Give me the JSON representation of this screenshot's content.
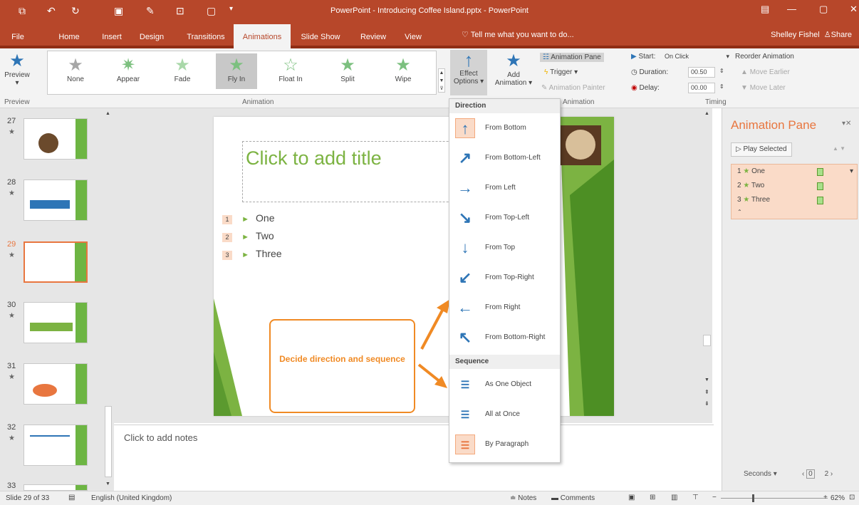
{
  "window": {
    "title": "PowerPoint - Introducing Coffee Island.pptx - PowerPoint"
  },
  "tabs": [
    "File",
    "Home",
    "Insert",
    "Design",
    "Transitions",
    "Animations",
    "Slide Show",
    "Review",
    "View"
  ],
  "tell_me": "Tell me what you want to do...",
  "user": {
    "name": "Shelley Fishel",
    "share": "Share"
  },
  "ribbon": {
    "preview": {
      "label": "Preview",
      "group": "Preview"
    },
    "animation_group": "Animation",
    "animations": [
      "None",
      "Appear",
      "Fade",
      "Fly In",
      "Float In",
      "Split",
      "Wipe"
    ],
    "selected_animation": "Fly In",
    "effect_options": {
      "line1": "Effect",
      "line2": "Options"
    },
    "add_animation": {
      "line1": "Add",
      "line2": "Animation"
    },
    "advanced": {
      "animation_pane": "Animation Pane",
      "trigger": "Trigger",
      "animation_painter": "Animation Painter",
      "group": "Animation"
    },
    "timing": {
      "start_label": "Start:",
      "start_value": "On Click",
      "duration_label": "Duration:",
      "duration_value": "00.50",
      "delay_label": "Delay:",
      "delay_value": "00.00",
      "group": "Timing"
    },
    "reorder": {
      "title": "Reorder Animation",
      "earlier": "Move Earlier",
      "later": "Move Later"
    }
  },
  "thumbnails": [
    {
      "num": "27"
    },
    {
      "num": "28"
    },
    {
      "num": "29"
    },
    {
      "num": "30"
    },
    {
      "num": "31"
    },
    {
      "num": "32"
    },
    {
      "num": "33"
    }
  ],
  "slide": {
    "title_placeholder": "Click to add title",
    "bullets": [
      {
        "tag": "1",
        "text": "One"
      },
      {
        "tag": "2",
        "text": "Two"
      },
      {
        "tag": "3",
        "text": "Three"
      }
    ]
  },
  "notes_placeholder": "Click to add notes",
  "callout": "Decide direction and sequence",
  "dropdown": {
    "direction_header": "Direction",
    "directions": [
      {
        "label": "From Bottom",
        "icon": "arrow-up-icon",
        "glyph": "↑"
      },
      {
        "label": "From Bottom-Left",
        "icon": "arrow-up-right-icon",
        "glyph": "↗"
      },
      {
        "label": "From Left",
        "icon": "arrow-right-icon",
        "glyph": "→"
      },
      {
        "label": "From Top-Left",
        "icon": "arrow-down-right-icon",
        "glyph": "↘"
      },
      {
        "label": "From Top",
        "icon": "arrow-down-icon",
        "glyph": "↓"
      },
      {
        "label": "From Top-Right",
        "icon": "arrow-down-left-icon",
        "glyph": "↙"
      },
      {
        "label": "From Right",
        "icon": "arrow-left-icon",
        "glyph": "←"
      },
      {
        "label": "From Bottom-Right",
        "icon": "arrow-up-left-icon",
        "glyph": "↖"
      }
    ],
    "sequence_header": "Sequence",
    "sequences": [
      {
        "label": "As One Object"
      },
      {
        "label": "All at Once"
      },
      {
        "label": "By Paragraph"
      }
    ]
  },
  "anim_pane": {
    "title": "Animation Pane",
    "play_selected": "Play Selected",
    "items": [
      {
        "num": "1",
        "label": "One"
      },
      {
        "num": "2",
        "label": "Two"
      },
      {
        "num": "3",
        "label": "Three"
      }
    ],
    "seconds_label": "Seconds",
    "timeline_start": "0",
    "timeline_end": "2"
  },
  "status": {
    "slide": "Slide 29 of 33",
    "language": "English (United Kingdom)",
    "notes": "Notes",
    "comments": "Comments",
    "zoom": "62%"
  },
  "colors": {
    "accent": "#b7472a",
    "green": "#7cb342",
    "callout": "#f08a24",
    "arrow": "#2e75b6"
  }
}
